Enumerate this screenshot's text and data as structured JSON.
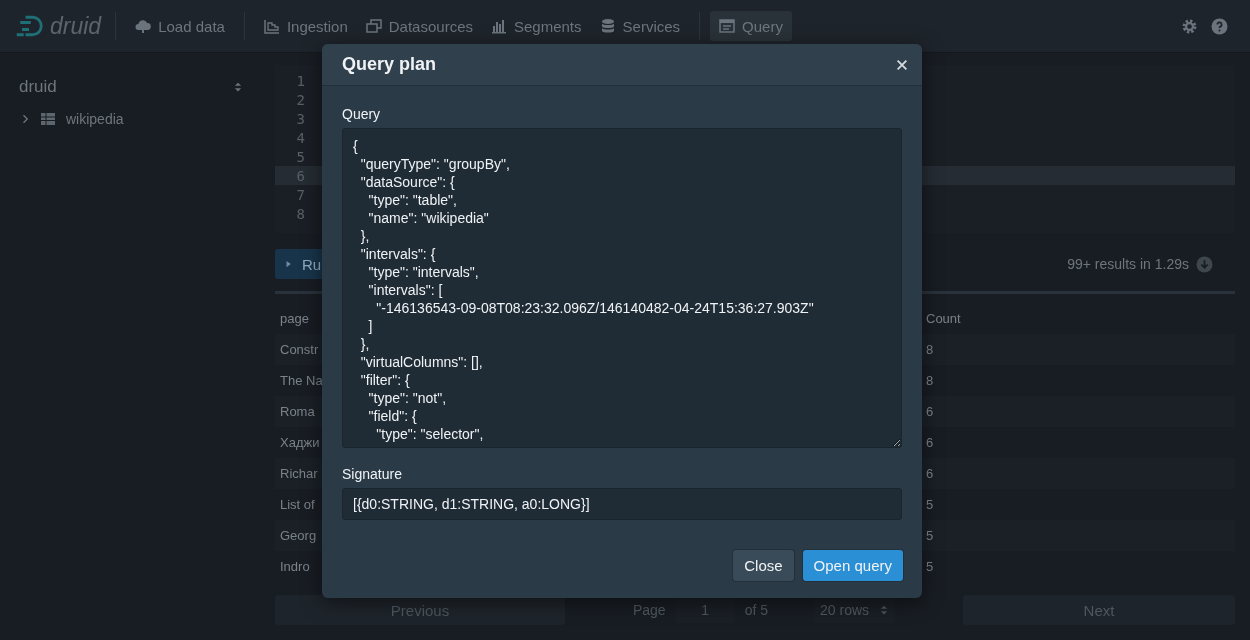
{
  "nav": {
    "logo": "druid",
    "items": [
      {
        "label": "Load data",
        "selected": false
      },
      {
        "label": "Ingestion",
        "selected": false
      },
      {
        "label": "Datasources",
        "selected": false
      },
      {
        "label": "Segments",
        "selected": false
      },
      {
        "label": "Services",
        "selected": false
      },
      {
        "label": "Query",
        "selected": true
      }
    ]
  },
  "sidebar": {
    "database": "druid",
    "tree": [
      {
        "label": "wikipedia",
        "expanded": false
      }
    ]
  },
  "editor": {
    "lines": [
      {
        "number": "1",
        "highlighted": false
      },
      {
        "number": "2",
        "highlighted": false
      },
      {
        "number": "3",
        "highlighted": false
      },
      {
        "number": "4",
        "highlighted": false
      },
      {
        "number": "5",
        "highlighted": false
      },
      {
        "number": "6",
        "highlighted": true
      },
      {
        "number": "7",
        "highlighted": false
      },
      {
        "number": "8",
        "highlighted": false
      }
    ]
  },
  "run_button": {
    "label": "Ru"
  },
  "results_summary": "99+ results in 1.29s",
  "table": {
    "columns": [
      "page",
      "Count"
    ],
    "rows": [
      [
        "Constr",
        "8"
      ],
      [
        "The Na",
        "8"
      ],
      [
        "Roma",
        "6"
      ],
      [
        "Хаджи",
        "6"
      ],
      [
        "Richar",
        "6"
      ],
      [
        "List of",
        "5"
      ],
      [
        "Georg",
        "5"
      ],
      [
        "Indro",
        "5"
      ]
    ]
  },
  "pagination": {
    "previous": "Previous",
    "page_label": "Page",
    "page_value": "1",
    "page_count": "of 5",
    "rows": "20 rows",
    "next": "Next"
  },
  "dialog": {
    "title": "Query plan",
    "query_label": "Query",
    "query": "{\n  \"queryType\": \"groupBy\",\n  \"dataSource\": {\n    \"type\": \"table\",\n    \"name\": \"wikipedia\"\n  },\n  \"intervals\": {\n    \"type\": \"intervals\",\n    \"intervals\": [\n      \"-146136543-09-08T08:23:32.096Z/146140482-04-24T15:36:27.903Z\"\n    ]\n  },\n  \"virtualColumns\": [],\n  \"filter\": {\n    \"type\": \"not\",\n    \"field\": {\n      \"type\": \"selector\",",
    "signature_label": "Signature",
    "signature": "[{d0:STRING, d1:STRING, a0:LONG}]",
    "buttons": [
      {
        "label": "Close",
        "kind": "default"
      },
      {
        "label": "Open query",
        "kind": "primary"
      }
    ]
  }
}
